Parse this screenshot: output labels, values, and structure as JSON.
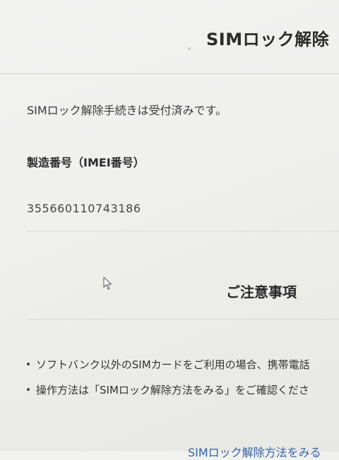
{
  "header": {
    "title": "SIMロック解除"
  },
  "status": {
    "message": "SIMロック解除手続きは受付済みです。"
  },
  "imei": {
    "label": "製造番号（IMEI番号）",
    "value": "355660110743186"
  },
  "notice": {
    "heading": "ご注意事項",
    "items": [
      {
        "text": "ソフトバンク以外のSIMカードをご利用の場合、携帯電話"
      },
      {
        "text": "操作方法は「SIMロック解除方法をみる」をご確認くださ"
      }
    ]
  },
  "links": {
    "bottom_link": "SIMロック解除方法をみる"
  },
  "icons": {
    "cursor": "mouse-pointer-icon"
  },
  "colors": {
    "link": "#3465a8",
    "background": "#efefec",
    "text": "#2e2e2e"
  }
}
